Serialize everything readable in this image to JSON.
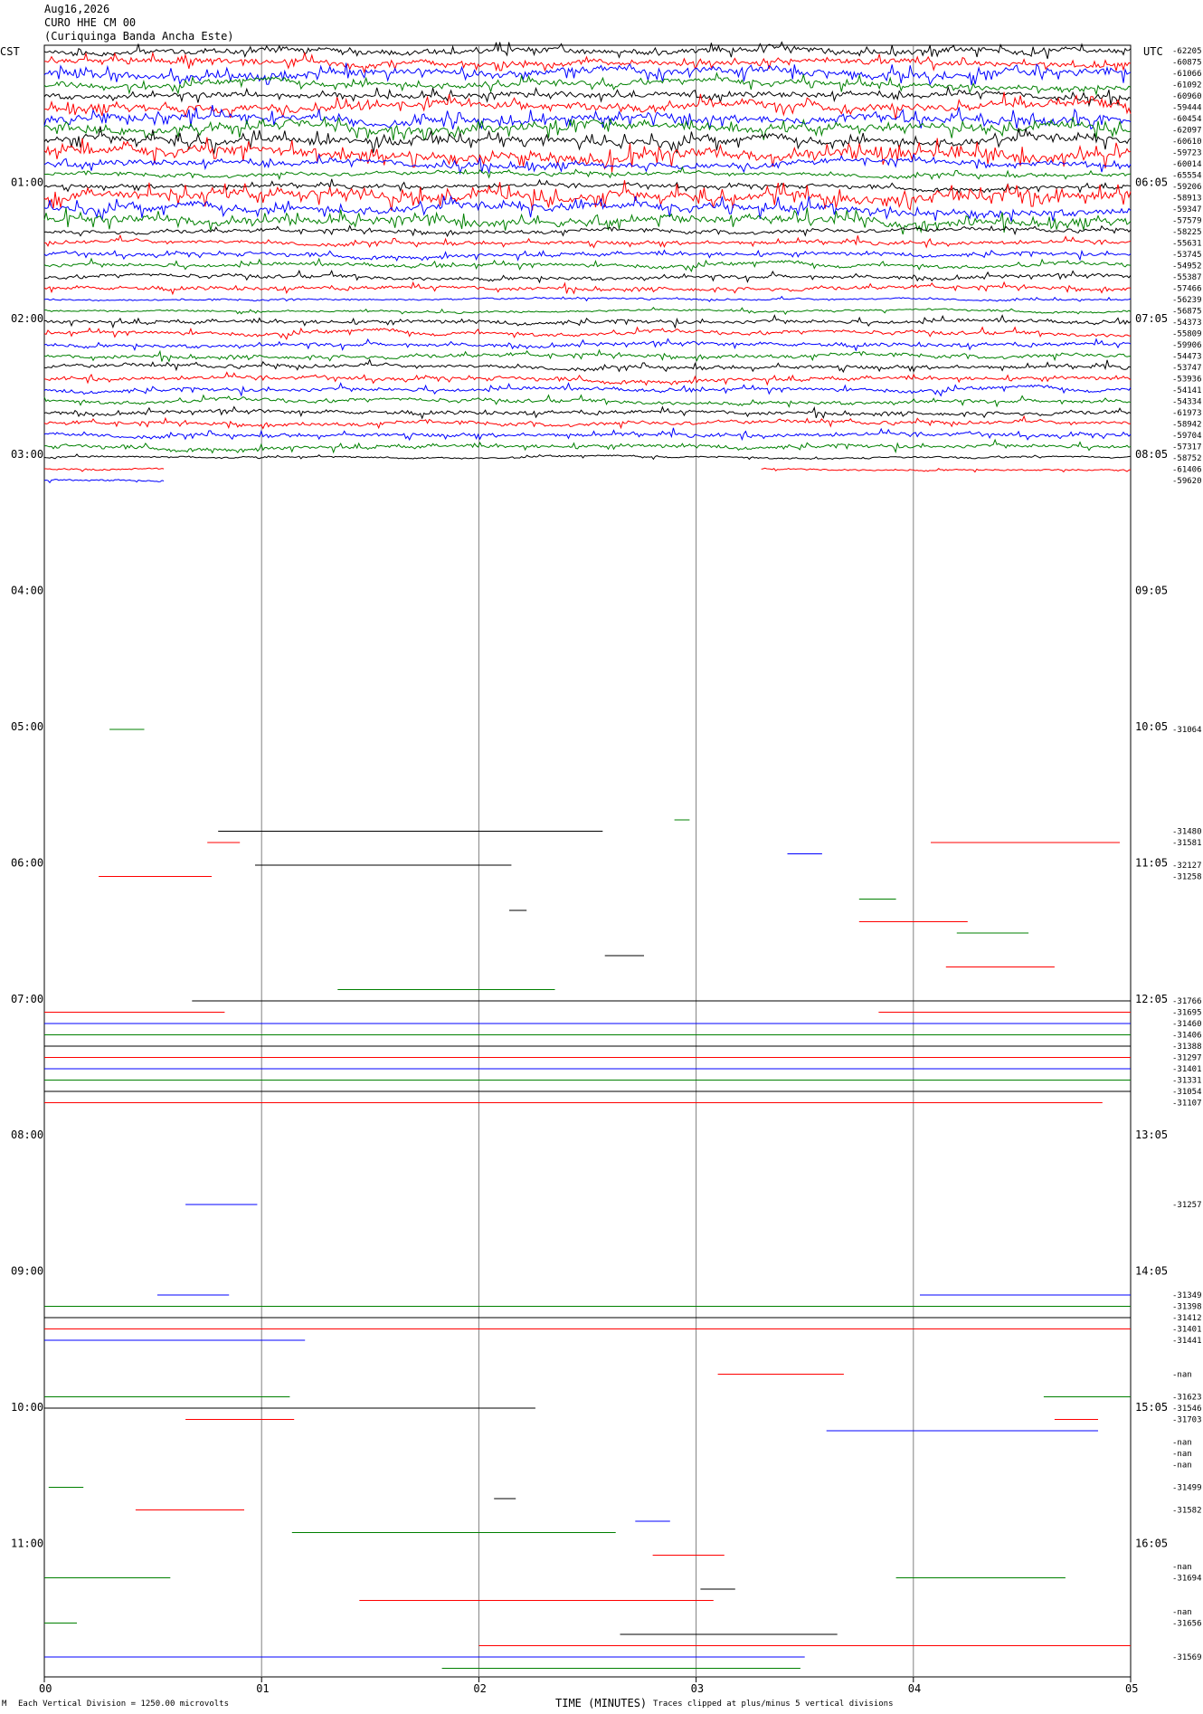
{
  "header": {
    "date": "Aug16,2026",
    "station": "CURO HHE CM 00",
    "name": "(Curiquinga Banda Ancha Este)"
  },
  "left_tz": "CST",
  "right_tz": "UTC",
  "footer": {
    "xlabel": "TIME (MINUTES)",
    "scale_note": "Each Vertical Division = 1250.00 microvolts",
    "clip_note": "Traces clipped at plus/minus 5 vertical divisions",
    "corner_mark": "M"
  },
  "colors": {
    "black": "#000000",
    "red": "#ff0000",
    "blue": "#0000ff",
    "green": "#008000",
    "grid": "#808080"
  },
  "chart_data": {
    "type": "line",
    "title": "CURO HHE CM 00",
    "xlabel": "TIME (MINUTES)",
    "x_ticks": [
      "00",
      "01",
      "02",
      "03",
      "04",
      "05"
    ],
    "xlim": [
      0,
      5
    ],
    "left_hour_labels": [
      "01:00",
      "02:00",
      "03:00",
      "04:00",
      "05:00",
      "06:00",
      "07:00",
      "08:00",
      "09:00",
      "10:00",
      "11:00"
    ],
    "right_hour_labels": [
      "06:05",
      "07:05",
      "08:05",
      "09:05",
      "10:05",
      "11:05",
      "12:05",
      "13:05",
      "14:05",
      "15:05",
      "16:05"
    ],
    "row_minutes": 5,
    "rows_per_hour": 12,
    "color_cycle": [
      "black",
      "red",
      "blue",
      "green"
    ],
    "traces": [
      {
        "row": 0,
        "color": "black",
        "label": "-62205",
        "start": 0,
        "end": 5,
        "noise": 3
      },
      {
        "row": 1,
        "color": "red",
        "label": "-60875",
        "start": 0,
        "end": 5,
        "noise": 3
      },
      {
        "row": 2,
        "color": "blue",
        "label": "-61066",
        "start": 0,
        "end": 5,
        "noise": 4
      },
      {
        "row": 3,
        "color": "green",
        "label": "-61092",
        "start": 0,
        "end": 5,
        "noise": 3
      },
      {
        "row": 4,
        "color": "black",
        "label": "-60960",
        "start": 0,
        "end": 5,
        "noise": 3
      },
      {
        "row": 5,
        "color": "red",
        "label": "-59444",
        "start": 0,
        "end": 5,
        "noise": 4
      },
      {
        "row": 6,
        "color": "blue",
        "label": "-60454",
        "start": 0,
        "end": 5,
        "noise": 4
      },
      {
        "row": 7,
        "color": "green",
        "label": "-62097",
        "start": 0,
        "end": 5,
        "noise": 4
      },
      {
        "row": 8,
        "color": "black",
        "label": "-60610",
        "start": 0,
        "end": 5,
        "noise": 4
      },
      {
        "row": 9,
        "color": "red",
        "label": "-59723",
        "start": 0,
        "end": 5,
        "noise": 5
      },
      {
        "row": 10,
        "color": "blue",
        "label": "-60014",
        "start": 0,
        "end": 5,
        "noise": 3
      },
      {
        "row": 11,
        "color": "green",
        "label": "-65554",
        "start": 0,
        "end": 5,
        "noise": 2
      },
      {
        "row": 12,
        "color": "black",
        "label": "-59206",
        "start": 0,
        "end": 5,
        "noise": 2
      },
      {
        "row": 13,
        "color": "red",
        "label": "-58913",
        "start": 0,
        "end": 5,
        "noise": 5
      },
      {
        "row": 14,
        "color": "blue",
        "label": "-59347",
        "start": 0,
        "end": 5,
        "noise": 4
      },
      {
        "row": 15,
        "color": "green",
        "label": "-57579",
        "start": 0,
        "end": 5,
        "noise": 4
      },
      {
        "row": 16,
        "color": "black",
        "label": "-58225",
        "start": 0,
        "end": 5,
        "noise": 2
      },
      {
        "row": 17,
        "color": "red",
        "label": "-55631",
        "start": 0,
        "end": 5,
        "noise": 2
      },
      {
        "row": 18,
        "color": "blue",
        "label": "-53745",
        "start": 0,
        "end": 5,
        "noise": 2
      },
      {
        "row": 19,
        "color": "green",
        "label": "-54952",
        "start": 0,
        "end": 5,
        "noise": 2
      },
      {
        "row": 20,
        "color": "black",
        "label": "-55387",
        "start": 0,
        "end": 5,
        "noise": 2
      },
      {
        "row": 21,
        "color": "red",
        "label": "-57466",
        "start": 0,
        "end": 5,
        "noise": 2
      },
      {
        "row": 22,
        "color": "blue",
        "label": "-56239",
        "start": 0,
        "end": 5,
        "noise": 1
      },
      {
        "row": 23,
        "color": "green",
        "label": "-56875",
        "start": 0,
        "end": 5,
        "noise": 1
      },
      {
        "row": 24,
        "color": "black",
        "label": "-54373",
        "start": 0,
        "end": 5,
        "noise": 2
      },
      {
        "row": 25,
        "color": "red",
        "label": "-55809",
        "start": 0,
        "end": 5,
        "noise": 2
      },
      {
        "row": 26,
        "color": "blue",
        "label": "-59906",
        "start": 0,
        "end": 5,
        "noise": 2
      },
      {
        "row": 27,
        "color": "green",
        "label": "-54473",
        "start": 0,
        "end": 5,
        "noise": 2
      },
      {
        "row": 28,
        "color": "black",
        "label": "-53747",
        "start": 0,
        "end": 5,
        "noise": 2
      },
      {
        "row": 29,
        "color": "red",
        "label": "-53936",
        "start": 0,
        "end": 5,
        "noise": 2
      },
      {
        "row": 30,
        "color": "blue",
        "label": "-54141",
        "start": 0,
        "end": 5,
        "noise": 2
      },
      {
        "row": 31,
        "color": "green",
        "label": "-54334",
        "start": 0,
        "end": 5,
        "noise": 2
      },
      {
        "row": 32,
        "color": "black",
        "label": "-61973",
        "start": 0,
        "end": 5,
        "noise": 2
      },
      {
        "row": 33,
        "color": "red",
        "label": "-58942",
        "start": 0,
        "end": 5,
        "noise": 2
      },
      {
        "row": 34,
        "color": "blue",
        "label": "-59704",
        "start": 0,
        "end": 5,
        "noise": 2
      },
      {
        "row": 35,
        "color": "green",
        "label": "-57317",
        "start": 0,
        "end": 5,
        "noise": 2
      },
      {
        "row": 36,
        "color": "black",
        "label": "-58752",
        "start": 0,
        "end": 5,
        "noise": 1
      },
      {
        "row": 37,
        "color": "red",
        "label": "-61406",
        "start": 0,
        "end": 0.55,
        "noise": 1
      },
      {
        "row": 37,
        "color": "red",
        "label": "",
        "start": 3.3,
        "end": 5,
        "noise": 1
      },
      {
        "row": 38,
        "color": "blue",
        "label": "-59620",
        "start": 0,
        "end": 0.55,
        "noise": 1
      },
      {
        "row": 60,
        "color": "green",
        "label": "-31064",
        "start": 0.3,
        "end": 0.46,
        "noise": 0
      },
      {
        "row": 68,
        "color": "green",
        "label": "",
        "start": 2.9,
        "end": 2.97,
        "noise": 0
      },
      {
        "row": 69,
        "color": "black",
        "label": "-31480",
        "start": 0.8,
        "end": 2.57,
        "noise": 0
      },
      {
        "row": 70,
        "color": "red",
        "label": "-31581",
        "start": 0.75,
        "end": 0.9,
        "noise": 0
      },
      {
        "row": 70,
        "color": "red",
        "label": "",
        "start": 4.08,
        "end": 4.95,
        "noise": 0
      },
      {
        "row": 71,
        "color": "blue",
        "label": "",
        "start": 3.42,
        "end": 3.58,
        "noise": 0
      },
      {
        "row": 72,
        "color": "black",
        "label": "-32127",
        "start": 0.97,
        "end": 2.15,
        "noise": 0
      },
      {
        "row": 73,
        "color": "red",
        "label": "-31258",
        "start": 0.25,
        "end": 0.77,
        "noise": 0
      },
      {
        "row": 75,
        "color": "green",
        "label": "",
        "start": 3.75,
        "end": 3.92,
        "noise": 0
      },
      {
        "row": 76,
        "color": "black",
        "label": "",
        "start": 2.14,
        "end": 2.22,
        "noise": 0
      },
      {
        "row": 77,
        "color": "red",
        "label": "",
        "start": 3.75,
        "end": 4.25,
        "noise": 0
      },
      {
        "row": 78,
        "color": "green",
        "label": "",
        "start": 4.2,
        "end": 4.53,
        "noise": 0
      },
      {
        "row": 80,
        "color": "black",
        "label": "",
        "start": 2.58,
        "end": 2.76,
        "noise": 0
      },
      {
        "row": 81,
        "color": "red",
        "label": "",
        "start": 4.15,
        "end": 4.65,
        "noise": 0
      },
      {
        "row": 83,
        "color": "green",
        "label": "",
        "start": 1.35,
        "end": 2.35,
        "noise": 0
      },
      {
        "row": 84,
        "color": "black",
        "label": "-31766",
        "start": 0.68,
        "end": 5,
        "noise": 0
      },
      {
        "row": 85,
        "color": "red",
        "label": "-31695",
        "start": 0,
        "end": 0.83,
        "noise": 0
      },
      {
        "row": 85,
        "color": "red",
        "label": "",
        "start": 3.84,
        "end": 5,
        "noise": 0
      },
      {
        "row": 86,
        "color": "blue",
        "label": "-31460",
        "start": 0,
        "end": 5,
        "noise": 0
      },
      {
        "row": 87,
        "color": "green",
        "label": "-31406",
        "start": 0,
        "end": 5,
        "noise": 0
      },
      {
        "row": 88,
        "color": "black",
        "label": "-31388",
        "start": 0,
        "end": 5,
        "noise": 0
      },
      {
        "row": 89,
        "color": "red",
        "label": "-31297",
        "start": 0,
        "end": 5,
        "noise": 0
      },
      {
        "row": 90,
        "color": "blue",
        "label": "-31401",
        "start": 0,
        "end": 5,
        "noise": 0
      },
      {
        "row": 91,
        "color": "green",
        "label": "-31331",
        "start": 0,
        "end": 5,
        "noise": 0
      },
      {
        "row": 92,
        "color": "black",
        "label": "-31054",
        "start": 0,
        "end": 5,
        "noise": 0
      },
      {
        "row": 93,
        "color": "red",
        "label": "-31107",
        "start": 0,
        "end": 4.87,
        "noise": 0
      },
      {
        "row": 102,
        "color": "blue",
        "label": "-31257",
        "start": 0.65,
        "end": 0.98,
        "noise": 0
      },
      {
        "row": 110,
        "color": "blue",
        "label": "-31349",
        "start": 0.52,
        "end": 0.85,
        "noise": 0
      },
      {
        "row": 110,
        "color": "blue",
        "label": "",
        "start": 4.03,
        "end": 5,
        "noise": 0
      },
      {
        "row": 111,
        "color": "green",
        "label": "-31398",
        "start": 0,
        "end": 5,
        "noise": 0
      },
      {
        "row": 112,
        "color": "black",
        "label": "-31412",
        "start": 0,
        "end": 5,
        "noise": 0
      },
      {
        "row": 113,
        "color": "red",
        "label": "-31401",
        "start": 0,
        "end": 5,
        "noise": 0
      },
      {
        "row": 114,
        "color": "blue",
        "label": "-31441",
        "start": 0,
        "end": 1.2,
        "noise": 0
      },
      {
        "row": 117,
        "color": "red",
        "label": "-nan",
        "start": 3.1,
        "end": 3.68,
        "noise": 0
      },
      {
        "row": 119,
        "color": "green",
        "label": "-31623",
        "start": 0,
        "end": 1.13,
        "noise": 0
      },
      {
        "row": 119,
        "color": "green",
        "label": "",
        "start": 4.6,
        "end": 5,
        "noise": 0
      },
      {
        "row": 120,
        "color": "black",
        "label": "-31546",
        "start": 0,
        "end": 2.26,
        "noise": 0
      },
      {
        "row": 121,
        "color": "red",
        "label": "-31703",
        "start": 0.65,
        "end": 1.15,
        "noise": 0
      },
      {
        "row": 121,
        "color": "red",
        "label": "",
        "start": 4.65,
        "end": 4.85,
        "noise": 0
      },
      {
        "row": 122,
        "color": "blue",
        "label": "",
        "start": 3.6,
        "end": 4.85,
        "noise": 0
      },
      {
        "row": 123,
        "color": "blue",
        "label": "-nan",
        "start": 0,
        "end": 0,
        "noise": 0
      },
      {
        "row": 124,
        "color": "green",
        "label": "-nan",
        "start": 0,
        "end": 0,
        "noise": 0
      },
      {
        "row": 125,
        "color": "black",
        "label": "-nan",
        "start": 0,
        "end": 0,
        "noise": 0
      },
      {
        "row": 127,
        "color": "green",
        "label": "-31499",
        "start": 0.02,
        "end": 0.18,
        "noise": 0
      },
      {
        "row": 128,
        "color": "black",
        "label": "",
        "start": 2.07,
        "end": 2.17,
        "noise": 0
      },
      {
        "row": 129,
        "color": "red",
        "label": "-31582",
        "start": 0.42,
        "end": 0.92,
        "noise": 0
      },
      {
        "row": 130,
        "color": "blue",
        "label": "",
        "start": 2.72,
        "end": 2.88,
        "noise": 0
      },
      {
        "row": 131,
        "color": "green",
        "label": "",
        "start": 1.14,
        "end": 2.63,
        "noise": 0
      },
      {
        "row": 133,
        "color": "red",
        "label": "",
        "start": 2.8,
        "end": 3.13,
        "noise": 0
      },
      {
        "row": 134,
        "color": "red",
        "label": "-nan",
        "start": 0,
        "end": 0,
        "noise": 0
      },
      {
        "row": 135,
        "color": "green",
        "label": "-31694",
        "start": 0,
        "end": 0.58,
        "noise": 0
      },
      {
        "row": 135,
        "color": "green",
        "label": "",
        "start": 3.92,
        "end": 4.7,
        "noise": 0
      },
      {
        "row": 136,
        "color": "black",
        "label": "",
        "start": 3.02,
        "end": 3.18,
        "noise": 0
      },
      {
        "row": 137,
        "color": "red",
        "label": "",
        "start": 1.45,
        "end": 3.08,
        "noise": 0
      },
      {
        "row": 138,
        "color": "blue",
        "label": "-nan",
        "start": 0,
        "end": 0,
        "noise": 0
      },
      {
        "row": 139,
        "color": "green",
        "label": "-31656",
        "start": 0,
        "end": 0.15,
        "noise": 0
      },
      {
        "row": 140,
        "color": "black",
        "label": "",
        "start": 2.65,
        "end": 3.65,
        "noise": 0
      },
      {
        "row": 141,
        "color": "red",
        "label": "",
        "start": 2,
        "end": 5,
        "noise": 0
      },
      {
        "row": 142,
        "color": "blue",
        "label": "-31569",
        "start": 0,
        "end": 3.5,
        "noise": 0
      },
      {
        "row": 143,
        "color": "green",
        "label": "",
        "start": 1.83,
        "end": 3.48,
        "noise": 0
      }
    ]
  }
}
